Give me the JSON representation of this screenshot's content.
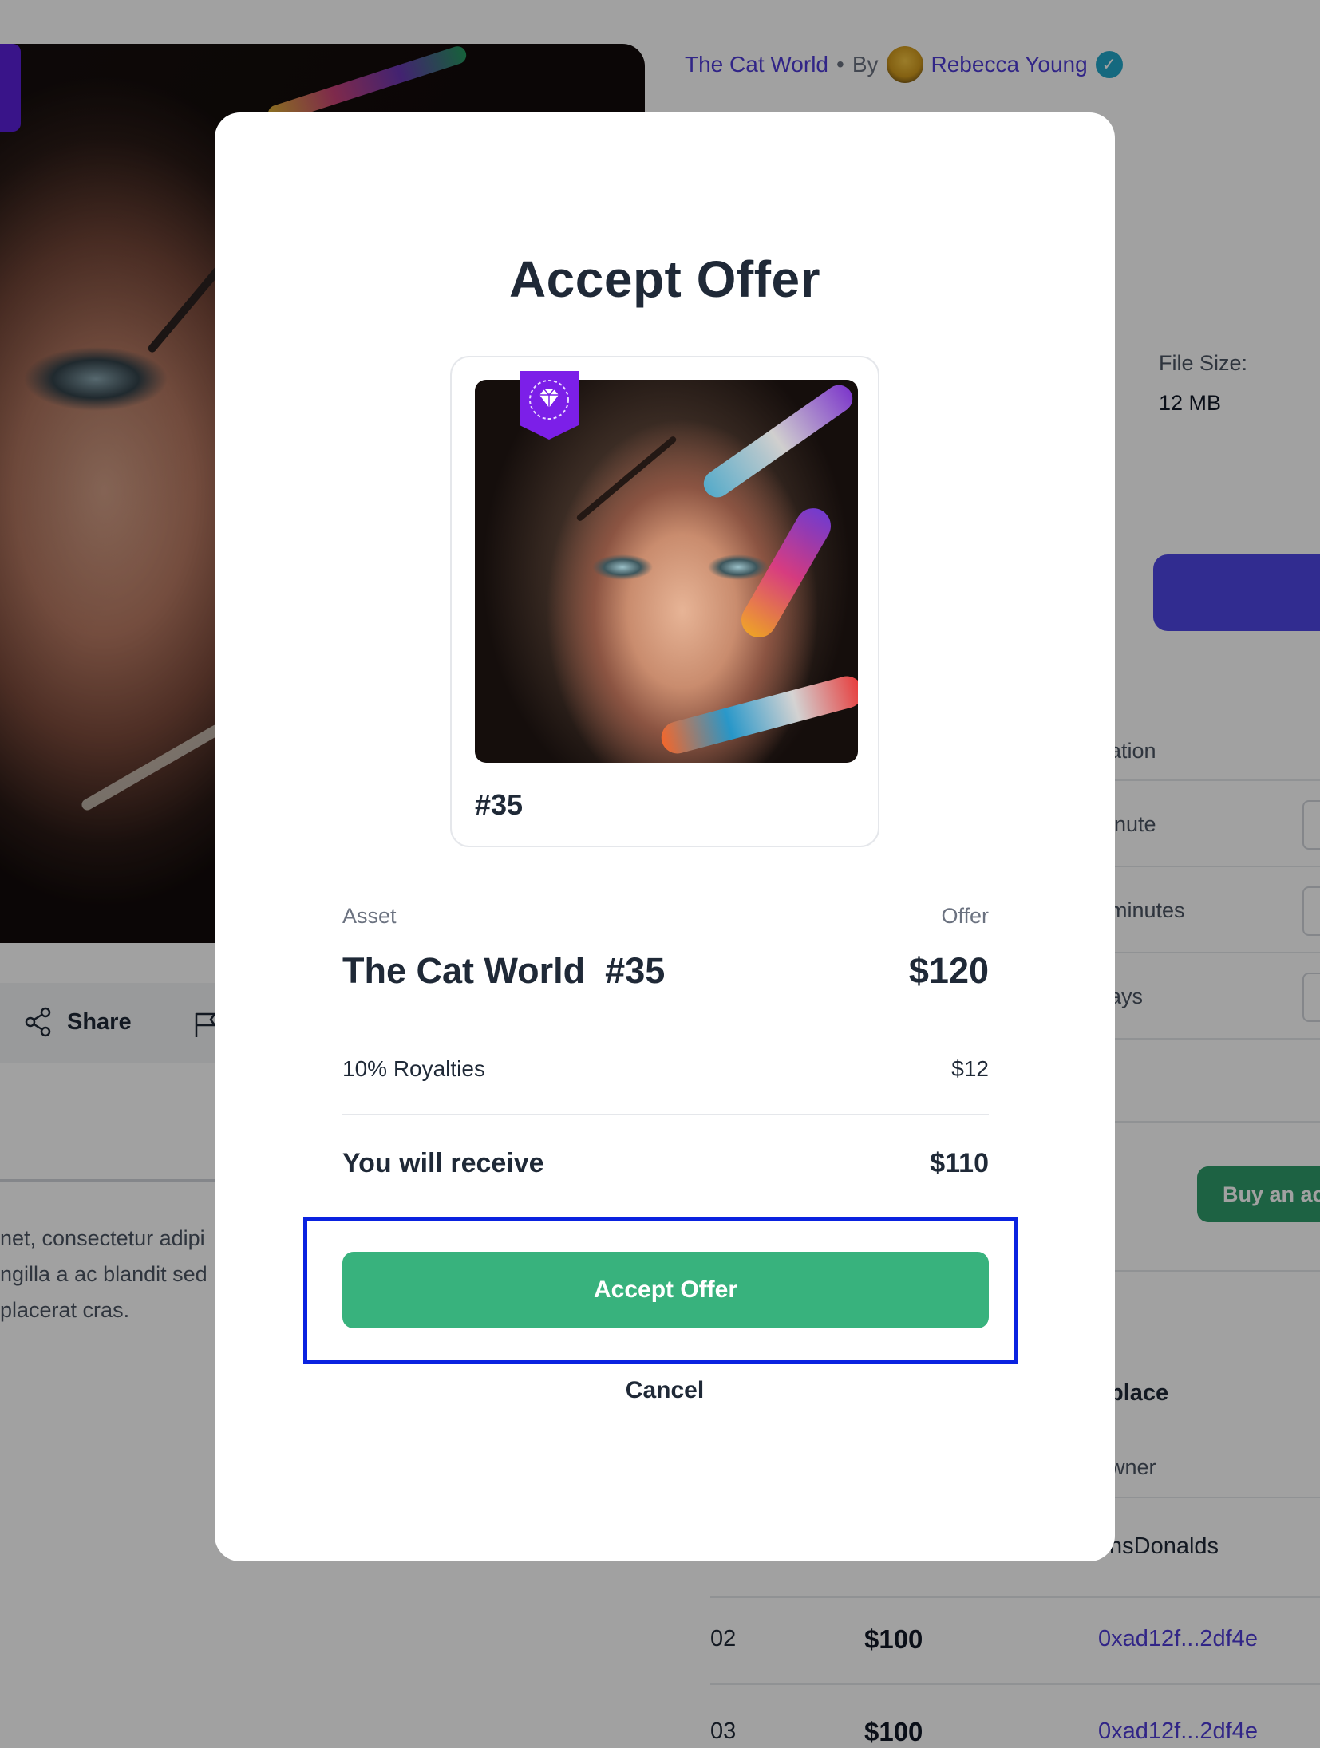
{
  "background": {
    "collection_name": "The Cat World",
    "separator": "•",
    "by_label": "By",
    "creator_name": "Rebecca Young",
    "file_size_label": "File Size:",
    "file_size_value": "12 MB",
    "duration_header_partial": "ation",
    "duration_rows": [
      "inute",
      "minutes",
      "ays"
    ],
    "share_label": "Share",
    "description_lines": [
      "net, consectetur adipi",
      "ngilla a ac blandit sed",
      "placerat cras."
    ],
    "buy_button_partial": "Buy an ac",
    "marketplace_partial": "place",
    "owner_header_partial": "wner",
    "owner_first_partial": "nsDonalds",
    "table_rows": [
      {
        "num": "02",
        "price": "$100",
        "address": "0xad12f...2df4e"
      },
      {
        "num": "03",
        "price": "$100",
        "address": "0xad12f...2df4e"
      }
    ]
  },
  "modal": {
    "title": "Accept Offer",
    "nft_label": "#35",
    "asset_header": "Asset",
    "offer_header": "Offer",
    "asset_name": "The Cat World  #35",
    "offer_amount": "$120",
    "royalties_label": "10% Royalties",
    "royalties_amount": "$12",
    "receive_label": "You will receive",
    "receive_amount": "$110",
    "accept_button": "Accept Offer",
    "cancel_button": "Cancel"
  },
  "colors": {
    "accent_purple": "#4f3bd6",
    "accept_green": "#38b27d",
    "focus_blue": "#0a22e0",
    "badge_purple": "#7c1fe8"
  }
}
